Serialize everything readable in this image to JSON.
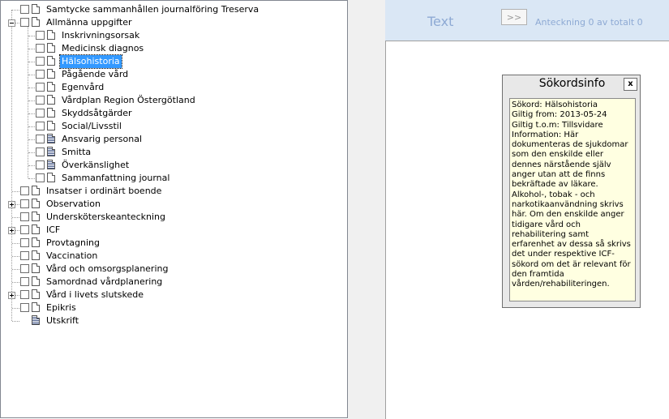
{
  "tree": {
    "items": [
      {
        "label": "Samtycke sammanhållen journalföring Treserva",
        "level": 0,
        "expander": "none",
        "icon": "document-icon"
      },
      {
        "label": "Allmänna uppgifter",
        "level": 0,
        "expander": "minus",
        "icon": "document-icon"
      },
      {
        "label": "Inskrivningsorsak",
        "level": 1,
        "expander": "none",
        "icon": "document-icon"
      },
      {
        "label": "Medicinsk diagnos",
        "level": 1,
        "expander": "none",
        "icon": "document-icon"
      },
      {
        "label": "Hälsohistoria",
        "level": 1,
        "expander": "none",
        "icon": "document-icon",
        "selected": true
      },
      {
        "label": "Pågående vård",
        "level": 1,
        "expander": "none",
        "icon": "document-icon"
      },
      {
        "label": "Egenvård",
        "level": 1,
        "expander": "none",
        "icon": "document-icon"
      },
      {
        "label": "Vårdplan Region Östergötland",
        "level": 1,
        "expander": "none",
        "icon": "document-icon"
      },
      {
        "label": "Skyddsåtgärder",
        "level": 1,
        "expander": "none",
        "icon": "document-icon"
      },
      {
        "label": "Social/Livsstil",
        "level": 1,
        "expander": "none",
        "icon": "document-icon"
      },
      {
        "label": "Ansvarig personal",
        "level": 1,
        "expander": "none",
        "icon": "list-document-icon"
      },
      {
        "label": "Smitta",
        "level": 1,
        "expander": "none",
        "icon": "list-document-icon"
      },
      {
        "label": "Överkänslighet",
        "level": 1,
        "expander": "none",
        "icon": "list-document-icon"
      },
      {
        "label": "Sammanfattning journal",
        "level": 1,
        "expander": "none",
        "icon": "document-icon"
      },
      {
        "label": "Insatser i ordinärt boende",
        "level": 0,
        "expander": "none",
        "icon": "document-icon"
      },
      {
        "label": "Observation",
        "level": 0,
        "expander": "plus",
        "icon": "document-icon"
      },
      {
        "label": "Undersköterskeanteckning",
        "level": 0,
        "expander": "none",
        "icon": "document-icon"
      },
      {
        "label": "ICF",
        "level": 0,
        "expander": "plus",
        "icon": "document-icon"
      },
      {
        "label": "Provtagning",
        "level": 0,
        "expander": "none",
        "icon": "document-icon"
      },
      {
        "label": "Vaccination",
        "level": 0,
        "expander": "none",
        "icon": "document-icon"
      },
      {
        "label": "Vård och omsorgsplanering",
        "level": 0,
        "expander": "none",
        "icon": "document-icon"
      },
      {
        "label": "Samordnad vårdplanering",
        "level": 0,
        "expander": "none",
        "icon": "document-icon"
      },
      {
        "label": "Vård i livets slutskede",
        "level": 0,
        "expander": "plus",
        "icon": "document-icon"
      },
      {
        "label": "Epikris",
        "level": 0,
        "expander": "none",
        "icon": "document-icon"
      },
      {
        "label": "Utskrift",
        "level": 0,
        "expander": "none",
        "icon": "list-document-icon",
        "no_checkbox": true
      }
    ]
  },
  "toolbar": {
    "text_label": "Text",
    "next_label": ">>",
    "note_count": "Anteckning 0 av totalt 0"
  },
  "dialog": {
    "title": "Sökordsinfo",
    "close_label": "x",
    "lines": [
      "Sökord: Hälsohistoria",
      "Giltig from: 2013-05-24",
      "Giltig t.o.m: Tillsvidare",
      "Information: Här dokumenteras de sjukdomar som den enskilde eller dennes närstående själv anger utan att de finns bekräftade av läkare. Alkohol-, tobak - och narkotikaanvändning skrivs här. Om den enskilde anger tidigare vård och rehabilitering samt erfarenhet av dessa så skrivs det under respektive ICF-sökord om det är relevant för den framtida vården/rehabiliteringen."
    ]
  },
  "colors": {
    "selection": "#3399ff",
    "toolbar_bg": "#dae7f5",
    "toolbar_text": "#8eaad4",
    "info_bg": "#ffffe1"
  }
}
